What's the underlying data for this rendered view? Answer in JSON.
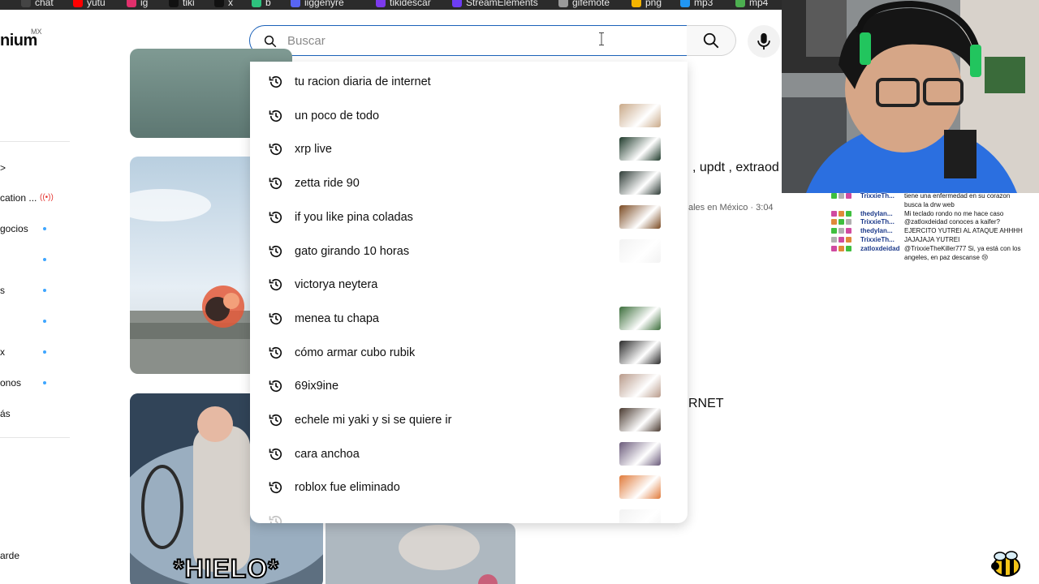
{
  "bookmarks": [
    {
      "label": "chat",
      "icon": "chat-icon",
      "color": "#444444"
    },
    {
      "label": "yutu",
      "icon": "youtube-icon",
      "color": "#ff0000"
    },
    {
      "label": "ig",
      "icon": "instagram-icon",
      "color": "#e1306c"
    },
    {
      "label": "tiki",
      "icon": "tiktok-icon",
      "color": "#111111"
    },
    {
      "label": "x",
      "icon": "x-icon",
      "color": "#111111"
    },
    {
      "label": "b",
      "icon": "b-icon",
      "color": "#2ec27e"
    },
    {
      "label": "iiggenyre",
      "icon": "discord-icon",
      "color": "#5865f2"
    },
    {
      "label": "tikidescar",
      "icon": "download-icon",
      "color": "#7c3aed"
    },
    {
      "label": "StreamElements",
      "icon": "streamelements-icon",
      "color": "#6d3df5"
    },
    {
      "label": "gifemote",
      "icon": "gif-icon",
      "color": "#9a9a9a"
    },
    {
      "label": "png",
      "icon": "png-icon",
      "color": "#f4b400"
    },
    {
      "label": "mp3",
      "icon": "mp3-icon",
      "color": "#2196f3"
    },
    {
      "label": "mp4",
      "icon": "mp4-icon",
      "color": "#4caf50"
    }
  ],
  "header": {
    "logo_text": "nium",
    "logo_country": "MX",
    "search": {
      "placeholder": "Buscar",
      "value": ""
    }
  },
  "sidebar": {
    "items": [
      {
        "label": ">",
        "has_dot": false
      },
      {
        "label": "cation ...",
        "has_dot": false,
        "live": true
      },
      {
        "label": "gocios",
        "has_dot": true
      },
      {
        "label": "",
        "has_dot": true
      },
      {
        "label": "s",
        "has_dot": true
      },
      {
        "label": "",
        "has_dot": true
      },
      {
        "label": "x",
        "has_dot": true
      },
      {
        "label": "onos",
        "has_dot": true
      },
      {
        "label": "ás",
        "has_dot": false
      },
      {
        "label": "arde",
        "has_dot": false
      }
    ]
  },
  "main": {
    "title_fragment": ", updt , extraod",
    "meta_fragment": "ales en México · 3:04",
    "title_fragment_2": "RNET",
    "thumb_caption": "*HIELO*"
  },
  "suggestions": [
    {
      "text": "tu racion diaria de internet",
      "thumb": null
    },
    {
      "text": "un poco de todo",
      "thumb": "#c9a988"
    },
    {
      "text": "xrp live",
      "thumb": "#1f3a2b"
    },
    {
      "text": "zetta ride 90",
      "thumb": "#2e3b36"
    },
    {
      "text": "if you like pina coladas",
      "thumb": "#7a4a22"
    },
    {
      "text": "gato girando 10 horas",
      "thumb": "#f2f2f2"
    },
    {
      "text": "victorya neytera",
      "thumb": null
    },
    {
      "text": "menea tu chapa",
      "thumb": "#3c6e3b"
    },
    {
      "text": "cómo armar cubo rubik",
      "thumb": "#2a2a2a"
    },
    {
      "text": "69ix9ine",
      "thumb": "#b89a8a"
    },
    {
      "text": "echele mi yaki y si se quiere ir",
      "thumb": "#4a3a30"
    },
    {
      "text": "cara anchoa",
      "thumb": "#6a5a7a"
    },
    {
      "text": "roblox fue eliminado",
      "thumb": "#e07a3a"
    },
    {
      "text": "",
      "thumb": "#cccccc"
    }
  ],
  "chat": [
    {
      "name": "TrixxieTh...",
      "msg": "tiene una enfermedad en su corazon"
    },
    {
      "name": "",
      "msg": "busca la drw web"
    },
    {
      "name": "thedylan...",
      "msg": "Mi teclado rondo no me hace caso"
    },
    {
      "name": "TrixxieTh...",
      "msg": "@zatloxdeidad conoces a kaifer?"
    },
    {
      "name": "thedylan...",
      "msg": "EJERCITO YUTREI AL ATAQUE AHHHH"
    },
    {
      "name": "TrixxieTh...",
      "msg": "JAJAJAJA YUTREI"
    },
    {
      "name": "zatloxdeidad",
      "msg": "@TrixxieTheKiller777 Si, ya está con los"
    },
    {
      "name": "",
      "msg": "angeles, en paz descanse 😢"
    }
  ],
  "colors": {
    "accent": "#1c62b9",
    "live": "#e53935",
    "sidebar_dot": "#3ea6ff",
    "chat_green": "#3fbf3f"
  }
}
